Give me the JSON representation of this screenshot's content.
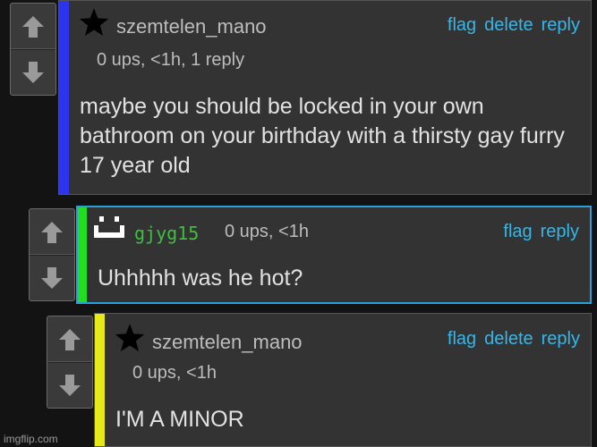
{
  "colors": {
    "accent_link": "#35b7ea",
    "stripe_blue": "#2e33ee",
    "stripe_green": "#22dd22",
    "stripe_yellow": "#e8e818",
    "username_green": "#3fbf3f",
    "active_border": "#2b9fd8"
  },
  "comments": [
    {
      "username": "szemtelen_mano",
      "avatar_icon": "black-star-icon",
      "meta": "0 ups, <1h, 1 reply",
      "actions": [
        "flag",
        "delete",
        "reply"
      ],
      "text": "maybe you should be locked in your own bathroom on your birthday with a thirsty gay furry 17 year old"
    },
    {
      "username": "gjyg15",
      "avatar_icon": "smiley-face-icon",
      "meta": "0 ups, <1h",
      "actions": [
        "flag",
        "reply"
      ],
      "text": "Uhhhhh was he hot?"
    },
    {
      "username": "szemtelen_mano",
      "avatar_icon": "black-star-icon",
      "meta": "0 ups, <1h",
      "actions": [
        "flag",
        "delete",
        "reply"
      ],
      "text": "I'M A MINOR"
    }
  ],
  "watermark": "imgflip.com"
}
